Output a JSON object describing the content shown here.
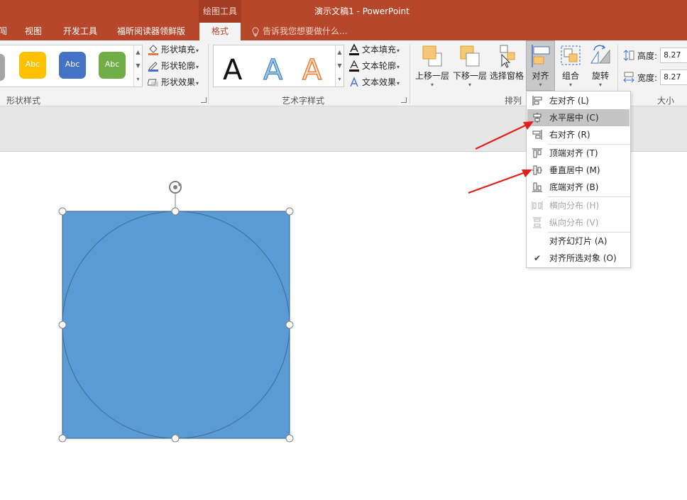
{
  "titlebar": {
    "context_label": "绘图工具",
    "doc_title": "演示文稿1 - PowerPoint"
  },
  "tabs": {
    "items": [
      "闯",
      "视图",
      "开发工具",
      "福昕阅读器领鲜版"
    ],
    "active": "格式",
    "tell_me": "告诉我您想要做什么..."
  },
  "ribbon": {
    "shape_styles": {
      "label": "形状样式",
      "swatches": [
        {
          "text": "Abc",
          "color": "#ffc000"
        },
        {
          "text": "Abc",
          "color": "#4472c4"
        },
        {
          "text": "Abc",
          "color": "#70ad47"
        }
      ],
      "fill": "形状填充",
      "outline": "形状轮廓",
      "effects": "形状效果"
    },
    "wordart_styles": {
      "label": "艺术字样式",
      "samples": [
        "A",
        "A",
        "A"
      ],
      "text_fill": "文本填充",
      "text_outline": "文本轮廓",
      "text_effects": "文本效果"
    },
    "arrange": {
      "label": "排列",
      "bring_forward": "上移一层",
      "send_backward": "下移一层",
      "selection_pane": "选择窗格",
      "align": "对齐",
      "group": "组合",
      "rotate": "旋转"
    },
    "size": {
      "label": "大小",
      "height_label": "高度:",
      "height_value": "8.27",
      "width_label": "宽度:",
      "width_value": "8.27"
    }
  },
  "align_menu": {
    "items": [
      {
        "label": "左对齐 (L)",
        "icon": "align-left-icon"
      },
      {
        "label": "水平居中 (C)",
        "icon": "align-center-icon",
        "highlighted": true
      },
      {
        "label": "右对齐 (R)",
        "icon": "align-right-icon"
      },
      {
        "label": "顶端对齐 (T)",
        "icon": "align-top-icon"
      },
      {
        "label": "垂直居中 (M)",
        "icon": "align-middle-icon"
      },
      {
        "label": "底端对齐 (B)",
        "icon": "align-bottom-icon"
      },
      {
        "label": "横向分布 (H)",
        "icon": "distribute-horizontal-icon",
        "disabled": true
      },
      {
        "label": "纵向分布 (V)",
        "icon": "distribute-vertical-icon",
        "disabled": true
      },
      {
        "label": "对齐幻灯片 (A)",
        "icon": ""
      },
      {
        "label": "对齐所选对象 (O)",
        "icon": "check-icon",
        "checked": true
      }
    ]
  },
  "colors": {
    "accent": "#b7472a",
    "shape_fill": "#5b9bd5",
    "shape_stroke": "#41719c",
    "annotation_arrow": "#e0201b"
  }
}
